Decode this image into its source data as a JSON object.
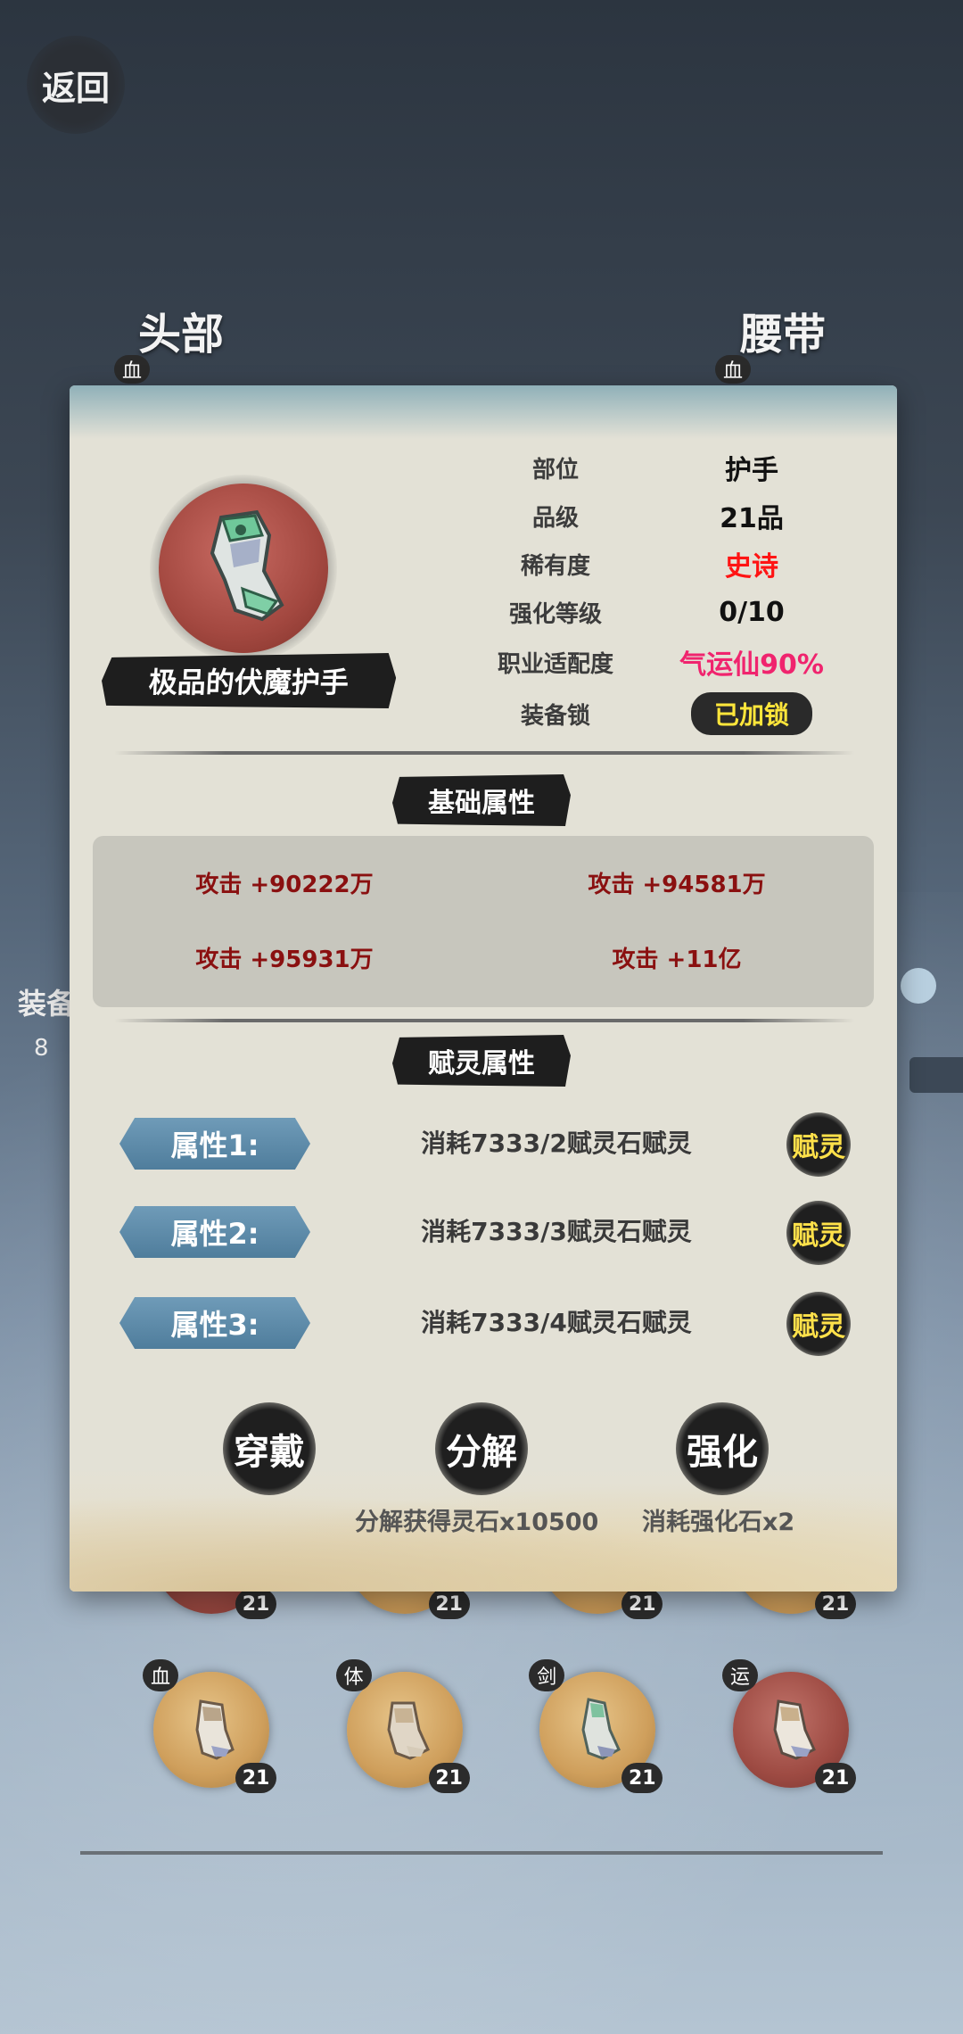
{
  "nav": {
    "back_label": "返回"
  },
  "slots": {
    "head_label": "头部",
    "belt_label": "腰带",
    "badge": "血"
  },
  "side": {
    "label": "装备",
    "count": "8"
  },
  "item": {
    "name": "极品的伏魔护手",
    "rows": [
      {
        "key": "部位",
        "value": "护手"
      },
      {
        "key": "品级",
        "value": "21品"
      },
      {
        "key": "稀有度",
        "value": "史诗"
      },
      {
        "key": "强化等级",
        "value": "0/10"
      },
      {
        "key": "职业适配度",
        "value": "气运仙90%"
      },
      {
        "key": "装备锁",
        "value": "已加锁"
      }
    ]
  },
  "base_section": {
    "title": "基础属性",
    "stats": [
      "攻击 +90222万",
      "攻击 +94581万",
      "攻击 +95931万",
      "攻击 +11亿"
    ]
  },
  "spirit_section": {
    "title": "赋灵属性",
    "rows": [
      {
        "tag": "属性1:",
        "cost": "消耗7333/2赋灵石赋灵",
        "button": "赋灵"
      },
      {
        "tag": "属性2:",
        "cost": "消耗7333/3赋灵石赋灵",
        "button": "赋灵"
      },
      {
        "tag": "属性3:",
        "cost": "消耗7333/4赋灵石赋灵",
        "button": "赋灵"
      }
    ]
  },
  "actions": {
    "wear": "穿戴",
    "decompose": "分解",
    "enhance": "强化",
    "decompose_note": "分解获得灵石x10500",
    "enhance_note": "消耗强化石x2"
  },
  "inventory": {
    "level": "21",
    "row2_tags": [
      "血",
      "体",
      "剑",
      "运"
    ]
  },
  "colors": {
    "rarity": "#ff1414",
    "fit": "#f0246e",
    "lock_text": "#ffe63b",
    "base_stat": "#8a1010"
  }
}
